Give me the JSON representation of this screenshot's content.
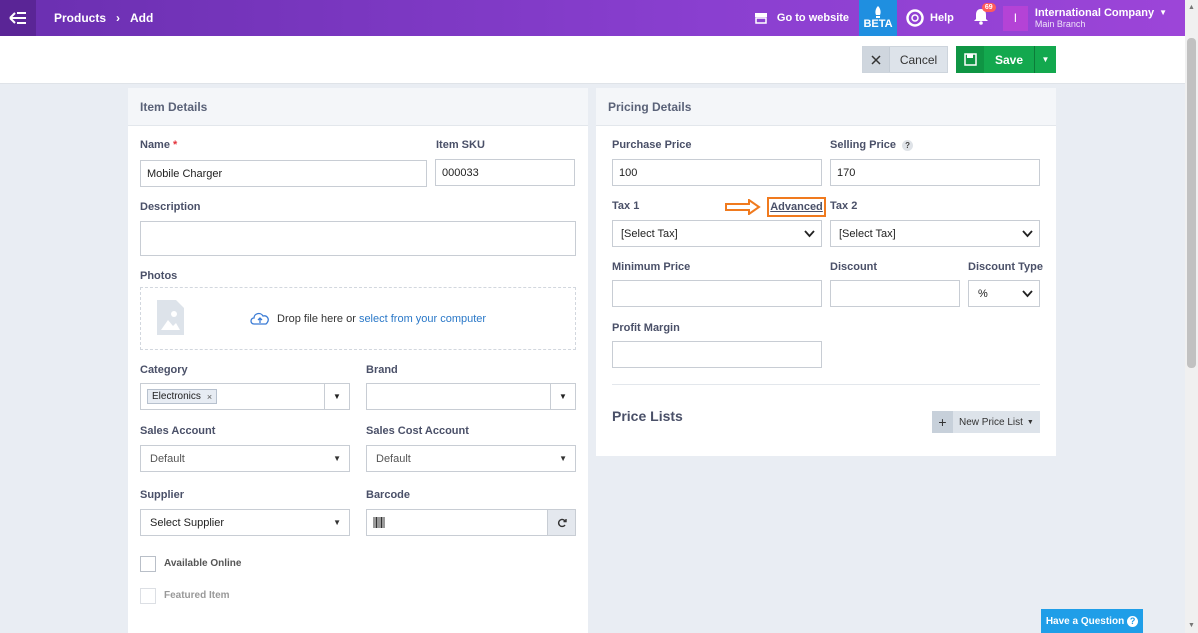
{
  "topbar": {
    "breadcrumb": [
      "Products",
      "Add"
    ],
    "goto_website": "Go to website",
    "beta": "BETA",
    "help": "Help",
    "notifications_count": "69",
    "avatar_letter": "I",
    "company_name": "International Company",
    "branch": "Main Branch"
  },
  "actions": {
    "cancel": "Cancel",
    "save": "Save"
  },
  "item_details": {
    "title": "Item Details",
    "name_label": "Name",
    "name_value": "Mobile Charger",
    "sku_label": "Item SKU",
    "sku_value": "000033",
    "description_label": "Description",
    "photos_label": "Photos",
    "drop_text": "Drop file here or",
    "drop_link": "select from your computer",
    "category_label": "Category",
    "category_tag": "Electronics",
    "brand_label": "Brand",
    "sales_account_label": "Sales Account",
    "sales_account_value": "Default",
    "sales_cost_label": "Sales Cost Account",
    "sales_cost_value": "Default",
    "supplier_label": "Supplier",
    "supplier_value": "Select Supplier",
    "barcode_label": "Barcode",
    "available_online": "Available Online",
    "featured_item": "Featured Item"
  },
  "pricing": {
    "title": "Pricing Details",
    "purchase_label": "Purchase Price",
    "purchase_value": "100",
    "selling_label": "Selling Price",
    "selling_value": "170",
    "tax1_label": "Tax 1",
    "advanced": "Advanced",
    "tax2_label": "Tax 2",
    "tax1_value": "[Select Tax]",
    "tax2_value": "[Select Tax]",
    "min_price_label": "Minimum Price",
    "discount_label": "Discount",
    "discount_type_label": "Discount Type",
    "discount_type_value": "%",
    "profit_margin_label": "Profit Margin",
    "price_lists": "Price Lists",
    "new_price_list": "New Price List"
  },
  "have_question": "Have a Question",
  "colors": {
    "topbar": "#7a35c0",
    "save": "#13a84e",
    "beta": "#1f8fe0",
    "highlight": "#f07a1e"
  }
}
